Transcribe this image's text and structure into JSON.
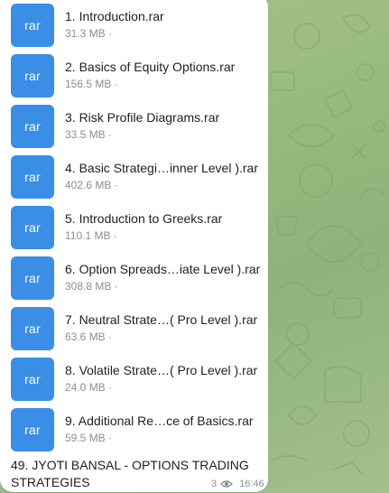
{
  "files": [
    {
      "icon": "rar-file-icon",
      "ext": "rar",
      "name": "1. Introduction.rar",
      "size": "31.3 MB ·"
    },
    {
      "icon": "rar-file-icon",
      "ext": "rar",
      "name": "2. Basics of Equity Options.rar",
      "size": "156.5 MB ·"
    },
    {
      "icon": "rar-file-icon",
      "ext": "rar",
      "name": "3. Risk Profile Diagrams.rar",
      "size": "33.5 MB ·"
    },
    {
      "icon": "rar-file-icon",
      "ext": "rar",
      "name": "4. Basic Strategi…inner Level ).rar",
      "size": "402.6 MB ·"
    },
    {
      "icon": "rar-file-icon",
      "ext": "rar",
      "name": "5. Introduction to Greeks.rar",
      "size": "110.1 MB ·"
    },
    {
      "icon": "rar-file-icon",
      "ext": "rar",
      "name": "6. Option Spreads…iate Level ).rar",
      "size": "308.8 MB ·"
    },
    {
      "icon": "rar-file-icon",
      "ext": "rar",
      "name": "7. Neutral Strate…( Pro Level ).rar",
      "size": "63.6 MB ·"
    },
    {
      "icon": "rar-file-icon",
      "ext": "rar",
      "name": "8. Volatile Strate…( Pro Level ).rar",
      "size": "24.0 MB ·"
    },
    {
      "icon": "rar-file-icon",
      "ext": "rar",
      "name": "9. Additional Re…ce of Basics.rar",
      "size": "59.5 MB ·"
    }
  ],
  "message": {
    "caption": "49. JYOTI BANSAL - OPTIONS TRADING STRATEGIES",
    "views": "3",
    "views_icon": "eye-icon",
    "time": "16:46"
  },
  "colors": {
    "file_icon_bg": "#3a8ee6",
    "wallpaper": "#97b97e",
    "bubble": "#ffffff",
    "meta_text": "#8a8f94"
  }
}
